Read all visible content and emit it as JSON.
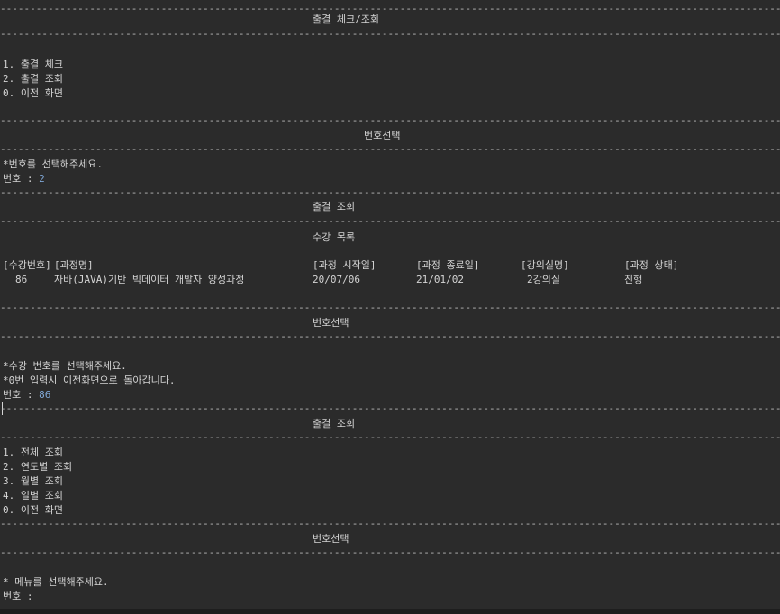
{
  "separator": "----------------------------------------------------------------------------------------------------------------------------------------------------------------",
  "section1": {
    "title": "출결 체크/조회",
    "menu": [
      "1. 출결 체크",
      "2. 출결 조회",
      "0. 이전 화면"
    ]
  },
  "section2": {
    "title": "번호선택",
    "prompt": "*번호를 선택해주세요.",
    "input_label": "번호 : ",
    "input_value": "2"
  },
  "section3": {
    "title": "출결 조회",
    "subtitle": "수강 목록",
    "headers": [
      "[수강번호]",
      "[과정명]",
      "[과정 시작일]",
      "[과정 종료일]",
      "[강의실명]",
      "[과정 상태]"
    ],
    "rows": [
      [
        "86",
        "자바(JAVA)기반 빅데이터 개발자 양성과정",
        "20/07/06",
        "21/01/02",
        "2강의실",
        "진행"
      ]
    ]
  },
  "section4": {
    "title": "번호선택",
    "prompt1": "*수강 번호를 선택해주세요.",
    "prompt2": "*0번 입력시 이전화면으로 돌아갑니다.",
    "input_label": "번호 : ",
    "input_value": "86"
  },
  "section5": {
    "title": "출결 조회",
    "menu": [
      "1. 전체 조회",
      "2. 연도별 조회",
      "3. 월별 조회",
      "4. 일별 조회",
      "0. 이전 화면"
    ]
  },
  "section6": {
    "title": "번호선택",
    "prompt": "* 메뉴를 선택해주세요.",
    "input_label": "번호 : ",
    "input_value": ""
  }
}
